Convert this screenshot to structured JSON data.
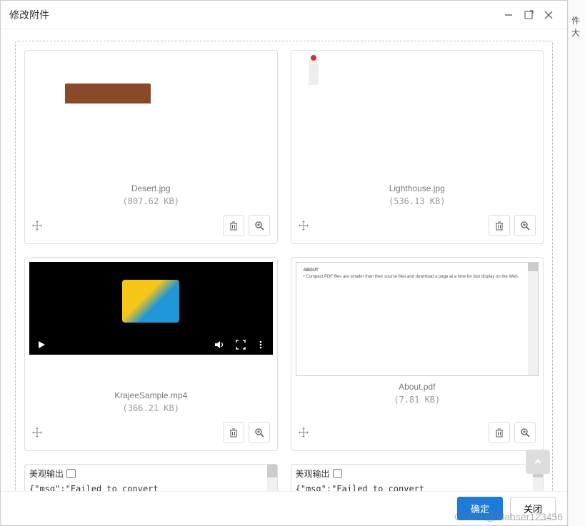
{
  "dialog": {
    "title": "修改附件",
    "side_text": "件大"
  },
  "files": [
    {
      "name": "Desert.jpg",
      "size": "(807.62 KB)"
    },
    {
      "name": "Lighthouse.jpg",
      "size": "(536.13 KB)"
    },
    {
      "name": "KrajeeSample.mp4",
      "size": "(366.21 KB)"
    },
    {
      "name": "About.pdf",
      "size": "(7.81 KB)"
    }
  ],
  "pdf": {
    "heading": "ABOUT",
    "line": "Compact PDF files are smaller than their source files and download a page at a time for fast display on the Web."
  },
  "output": {
    "label": "美观输出",
    "json_fragment": "{\"msg\":\"Failed to convert"
  },
  "buttons": {
    "confirm": "确定",
    "close": "关闭"
  },
  "icons": {
    "minimize": "minimize-icon",
    "maximize": "maximize-icon",
    "close": "close-icon",
    "drag": "drag-icon",
    "trash": "trash-icon",
    "zoom": "zoom-in-icon",
    "play": "play-icon",
    "volume": "volume-icon",
    "fullscreen": "fullscreen-icon",
    "more": "more-icon",
    "scroll_top": "chevron-up-icon"
  },
  "watermark": "CSDN @Slahser123456"
}
